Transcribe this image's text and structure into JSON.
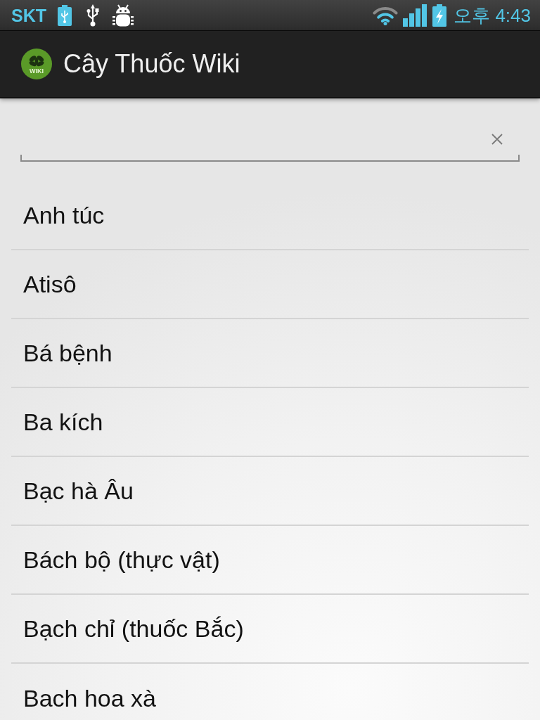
{
  "status_bar": {
    "carrier": "SKT",
    "time": "오후 4:43"
  },
  "app_bar": {
    "logo_text": "WIKI",
    "title": "Cây Thuốc Wiki"
  },
  "items": [
    {
      "label": "Anh túc"
    },
    {
      "label": "Atisô"
    },
    {
      "label": "Bá bệnh"
    },
    {
      "label": "Ba kích"
    },
    {
      "label": "Bạc hà Âu"
    },
    {
      "label": "Bách bộ (thực vật)"
    },
    {
      "label": "Bạch chỉ (thuốc Bắc)"
    },
    {
      "label": "Bach hoa xà"
    }
  ]
}
